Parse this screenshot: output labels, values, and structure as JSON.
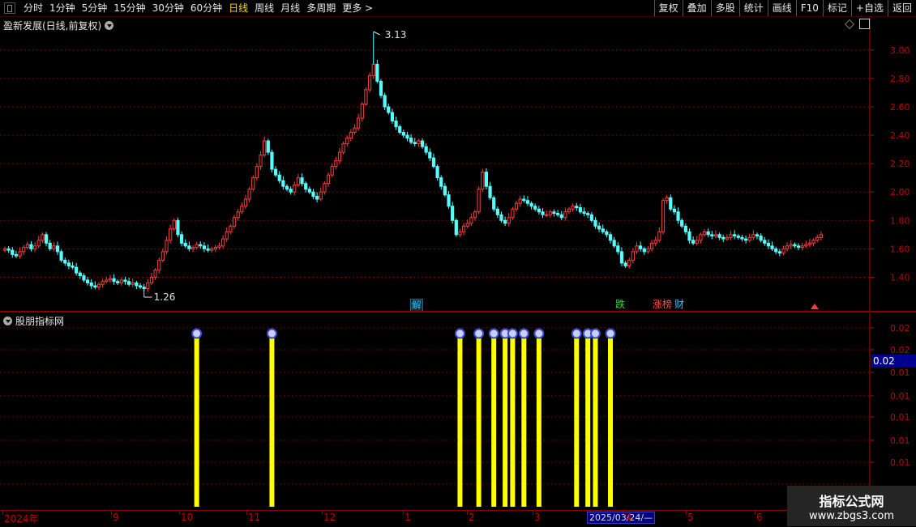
{
  "toolbar": {
    "periods": [
      "分时",
      "1分钟",
      "5分钟",
      "15分钟",
      "30分钟",
      "60分钟",
      "日线",
      "周线",
      "月线",
      "多周期",
      "更多 >"
    ],
    "active_period": "日线",
    "right": [
      "复权",
      "叠加",
      "多股",
      "统计",
      "画线",
      "F10",
      "标记",
      "+自选",
      "返回"
    ]
  },
  "main": {
    "title": "盈新发展(日线,前复权)",
    "high_label": "3.13",
    "low_label": "1.26",
    "signals": [
      {
        "text": "解",
        "color": "#33c0ff"
      },
      {
        "text": "跌",
        "color": "#33dd33"
      },
      {
        "text": "涨榜",
        "color": "#ff5050"
      },
      {
        "text": "财",
        "color": "#33c0ff"
      }
    ]
  },
  "sub": {
    "title": "股朋指标网",
    "cursor_value": "0.02",
    "y_tick_labels": [
      "0.02",
      "0.02",
      "0.01",
      "0.01",
      "0.01",
      "0.01",
      "0.01"
    ]
  },
  "dates": {
    "labels": [
      "2024年",
      "9",
      "10",
      "11",
      "12",
      "1",
      "2",
      "3",
      "4",
      "5",
      "6"
    ],
    "cursor": "2025/03/24/—"
  },
  "watermark": {
    "line1": "指标公式网",
    "line2": "www.zbgs3.com"
  },
  "colors": {
    "up": "#ff3b3b",
    "down": "#54ffff",
    "signal_bar": "#ffff00",
    "grid": "#7a0000",
    "axis": "#c00000"
  },
  "chart_data": [
    {
      "type": "candlestick",
      "ylim": [
        1.26,
        3.13
      ],
      "y_ticks": [
        3.0,
        2.8,
        2.6,
        2.4,
        2.2,
        2.0,
        1.8,
        1.6,
        1.4
      ],
      "close": [
        1.6,
        1.59,
        1.56,
        1.55,
        1.58,
        1.61,
        1.63,
        1.6,
        1.62,
        1.66,
        1.7,
        1.64,
        1.6,
        1.62,
        1.58,
        1.52,
        1.5,
        1.48,
        1.47,
        1.43,
        1.41,
        1.38,
        1.36,
        1.34,
        1.33,
        1.35,
        1.37,
        1.38,
        1.39,
        1.37,
        1.36,
        1.38,
        1.37,
        1.35,
        1.36,
        1.34,
        1.33,
        1.32,
        1.36,
        1.4,
        1.45,
        1.52,
        1.58,
        1.66,
        1.74,
        1.8,
        1.7,
        1.64,
        1.62,
        1.6,
        1.61,
        1.63,
        1.62,
        1.6,
        1.59,
        1.6,
        1.61,
        1.62,
        1.67,
        1.72,
        1.76,
        1.82,
        1.86,
        1.9,
        1.95,
        2.02,
        2.1,
        2.18,
        2.26,
        2.36,
        2.28,
        2.16,
        2.12,
        2.08,
        2.04,
        2.02,
        2.0,
        2.05,
        2.1,
        2.06,
        2.02,
        2.0,
        1.97,
        1.95,
        2.0,
        2.06,
        2.12,
        2.18,
        2.22,
        2.28,
        2.34,
        2.38,
        2.42,
        2.45,
        2.52,
        2.62,
        2.72,
        2.82,
        2.9,
        2.78,
        2.68,
        2.6,
        2.56,
        2.5,
        2.46,
        2.42,
        2.4,
        2.38,
        2.35,
        2.34,
        2.36,
        2.32,
        2.28,
        2.24,
        2.18,
        2.1,
        2.04,
        1.98,
        1.9,
        1.8,
        1.7,
        1.72,
        1.76,
        1.78,
        1.82,
        1.86,
        2.02,
        2.14,
        2.04,
        1.96,
        1.88,
        1.84,
        1.8,
        1.78,
        1.82,
        1.88,
        1.92,
        1.95,
        1.94,
        1.92,
        1.9,
        1.88,
        1.86,
        1.84,
        1.84,
        1.86,
        1.85,
        1.84,
        1.82,
        1.86,
        1.88,
        1.9,
        1.89,
        1.86,
        1.85,
        1.84,
        1.8,
        1.76,
        1.74,
        1.72,
        1.7,
        1.66,
        1.62,
        1.58,
        1.5,
        1.48,
        1.52,
        1.58,
        1.62,
        1.6,
        1.58,
        1.6,
        1.64,
        1.66,
        1.72,
        1.94,
        1.96,
        1.88,
        1.86,
        1.8,
        1.76,
        1.72,
        1.66,
        1.64,
        1.66,
        1.7,
        1.72,
        1.7,
        1.69,
        1.7,
        1.68,
        1.67,
        1.68,
        1.7,
        1.69,
        1.68,
        1.67,
        1.66,
        1.68,
        1.7,
        1.69,
        1.66,
        1.64,
        1.62,
        1.6,
        1.58,
        1.57,
        1.6,
        1.62,
        1.63,
        1.62,
        1.61,
        1.62,
        1.63,
        1.64,
        1.66,
        1.68,
        1.7
      ]
    },
    {
      "type": "bar",
      "y_ticks": [
        0.02,
        0.02,
        0.01,
        0.01,
        0.01,
        0.01,
        0.01
      ],
      "signal_days": [
        51,
        71,
        121,
        126,
        130,
        133,
        135,
        138,
        142,
        152,
        155,
        157,
        161
      ]
    }
  ]
}
